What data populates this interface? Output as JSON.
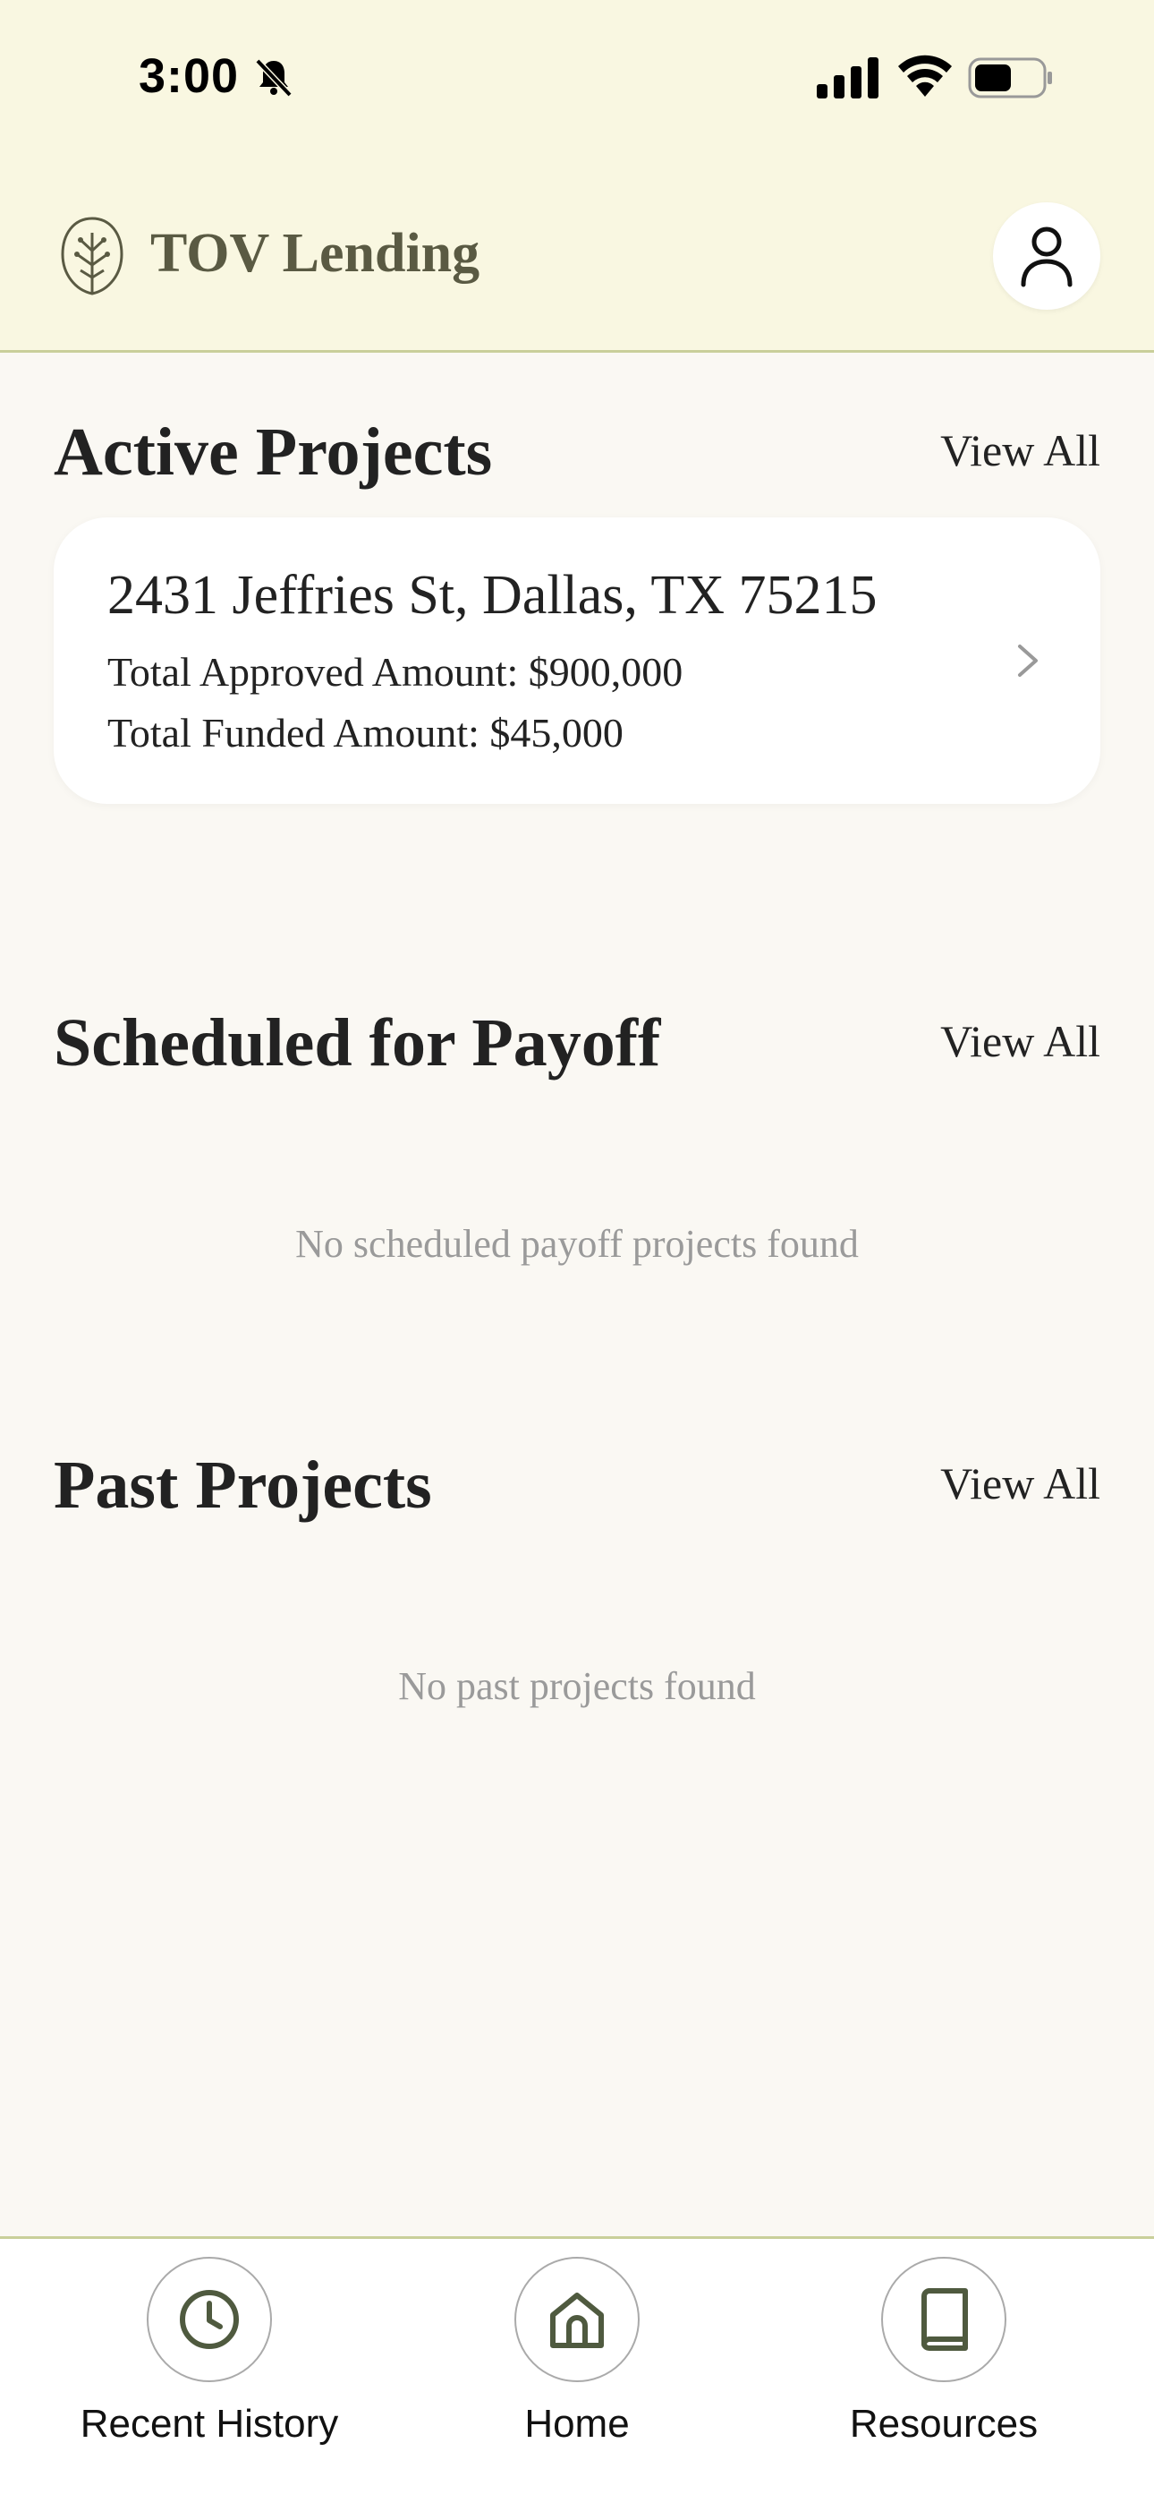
{
  "status_bar": {
    "time": "3:00"
  },
  "header": {
    "brand": "TOV Lending"
  },
  "active_projects": {
    "title": "Active Projects",
    "view_all": "View All",
    "card": {
      "address": "2431 Jeffries St, Dallas, TX 75215",
      "approved": "Total Approved Amount: $900,000",
      "funded": "Total Funded Amount: $45,000"
    }
  },
  "scheduled_payoff": {
    "title": "Scheduled for Payoff",
    "view_all": "View All",
    "empty": "No scheduled payoff projects found"
  },
  "past_projects": {
    "title": "Past Projects",
    "view_all": "View All",
    "empty": "No past projects found"
  },
  "bottom_nav": {
    "items": [
      {
        "label": "Recent History",
        "icon": "clock-icon"
      },
      {
        "label": "Home",
        "icon": "home-icon"
      },
      {
        "label": "Resources",
        "icon": "book-icon"
      }
    ]
  },
  "colors": {
    "header_bg": "#f9f7e1",
    "page_bg": "#faf8f3",
    "accent": "#5a5a43",
    "divider": "#c9cf9a"
  }
}
